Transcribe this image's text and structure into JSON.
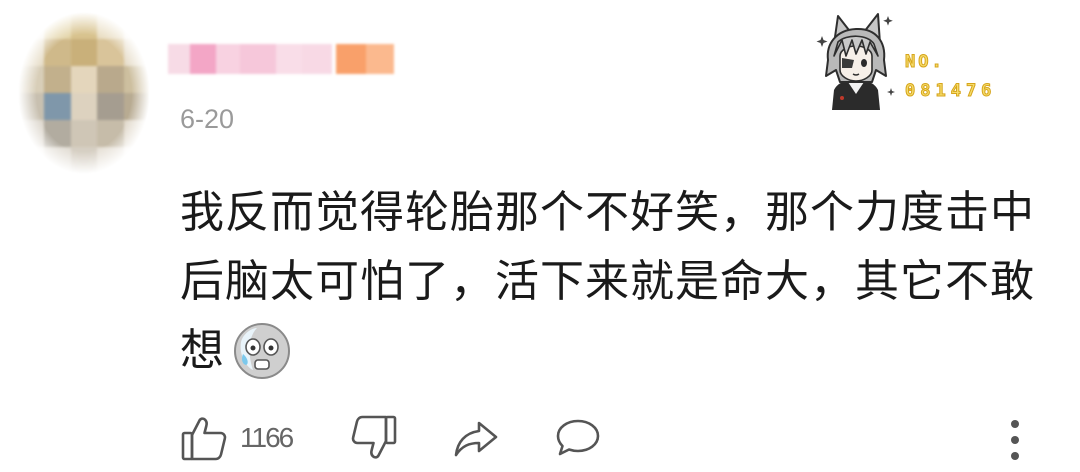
{
  "theme": {
    "background": "#ffffff",
    "text_color": "#1a1a1a",
    "date_color": "#9a9a9a",
    "icon_color": "#555555",
    "count_color": "#666666",
    "badge_fill": "#f6dc6a",
    "badge_outline": "#d6a51c"
  },
  "comment": {
    "date": "6-20",
    "fan_badge": {
      "image": "wolf-eared-character-icon",
      "label": "NO.",
      "number": "081476"
    },
    "content_lines": [
      "我反而觉得轮胎那个不好笑，那个力度击中",
      "后脑太可怕了，活下来就是命大，其它不敢",
      "想"
    ],
    "emoji": "scared-face-emoji-icon",
    "actions": {
      "like_icon": "thumb-up-icon",
      "like_count": "1166",
      "dislike_icon": "thumb-down-icon",
      "share_icon": "share-icon",
      "reply_icon": "comment-icon",
      "more_icon": "more-vertical-icon"
    }
  }
}
